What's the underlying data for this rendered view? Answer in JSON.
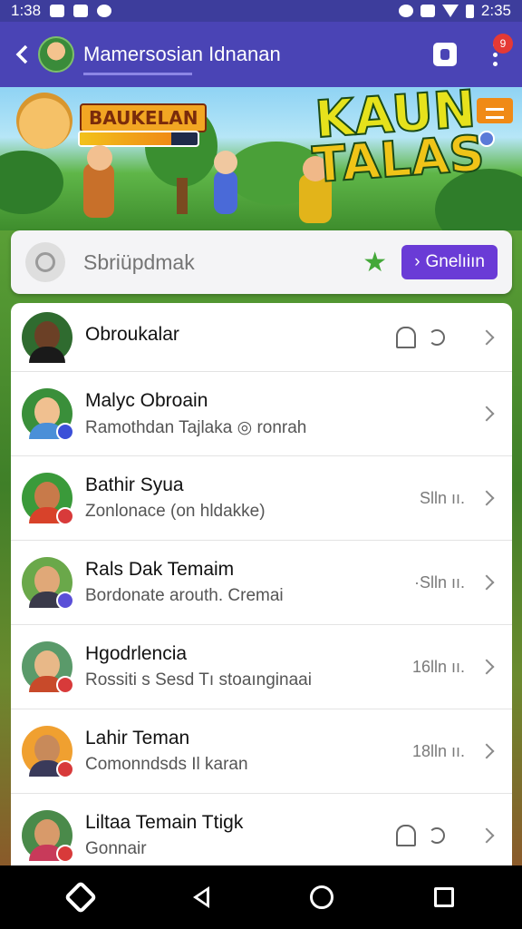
{
  "status_bar": {
    "time_left": "1:38",
    "time_right": "2:35"
  },
  "app_bar": {
    "title": "Mamersosiаn Idnanan",
    "notification_count": "9"
  },
  "banner": {
    "badge_text": "BAUKELAN",
    "progress": 0.78,
    "title_line1": "KAUN",
    "title_line2": "TALAS"
  },
  "search": {
    "placeholder": "Sbriüpdmak",
    "button_label": "Gnelıiın"
  },
  "list": {
    "items": [
      {
        "name": "Obroukalar",
        "subtitle": "",
        "time": "",
        "avatar_bg": "#2f6b2f",
        "face": "#6b4026",
        "body": "#1a1a1a",
        "dot": ""
      },
      {
        "name": "Malyc Obroain",
        "subtitle": "Ramothdan Tajlaka ◎ ronrah",
        "time": "",
        "avatar_bg": "#3a8f3a",
        "face": "#f0c090",
        "body": "#4a8fd8",
        "dot": "#3b4fd8"
      },
      {
        "name": "Bathir Syua",
        "subtitle": "Zonlonace (on hldakke)",
        "time": "Slln ıı.",
        "avatar_bg": "#3a9a3a",
        "face": "#c87a4a",
        "body": "#d8422a",
        "dot": "#d83a3a"
      },
      {
        "name": "Rals Dak Temaim",
        "subtitle": "Bordonate arouth. Cremai",
        "time": "·Slln ıı.",
        "avatar_bg": "#6aa84a",
        "face": "#e0a878",
        "body": "#3a3a4a",
        "dot": "#5a4fd8"
      },
      {
        "name": "Hgodrlencia",
        "subtitle": "Rossiti s Sesd Tı stoaınginaai",
        "time": "16lln ıı.",
        "avatar_bg": "#5a9a6a",
        "face": "#e8b888",
        "body": "#c84a2a",
        "dot": "#d83a3a"
      },
      {
        "name": "Lahir Teman",
        "subtitle": "Comonndsds Il karan",
        "time": "18lln ıı.",
        "avatar_bg": "#f0a030",
        "face": "#c88a5a",
        "body": "#3a3a5a",
        "dot": "#d83a3a"
      },
      {
        "name": "Liltaa Temain Ttigk",
        "subtitle": "Gonnair",
        "time": "",
        "avatar_bg": "#4a8a4a",
        "face": "#d89a6a",
        "body": "#c83a5a",
        "dot": "#d83a3a"
      }
    ]
  }
}
